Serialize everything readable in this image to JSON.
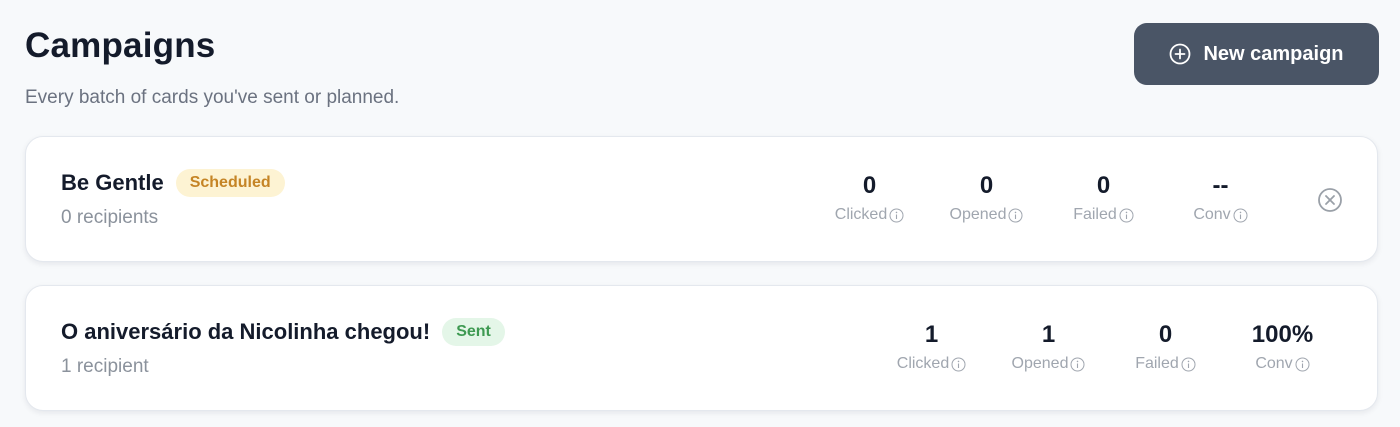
{
  "header": {
    "title": "Campaigns",
    "subtitle": "Every batch of cards you've sent or planned.",
    "new_button_label": "New campaign"
  },
  "campaigns": [
    {
      "name": "Be Gentle",
      "status": "Scheduled",
      "recipients": "0 recipients",
      "stats": [
        {
          "value": "0",
          "label": "Clicked"
        },
        {
          "value": "0",
          "label": "Opened"
        },
        {
          "value": "0",
          "label": "Failed"
        },
        {
          "value": "--",
          "label": "Conv"
        }
      ],
      "has_cancel": true
    },
    {
      "name": "O aniversário da Nicolinha chegou!",
      "status": "Sent",
      "recipients": "1 recipient",
      "stats": [
        {
          "value": "1",
          "label": "Clicked"
        },
        {
          "value": "1",
          "label": "Opened"
        },
        {
          "value": "0",
          "label": "Failed"
        },
        {
          "value": "100%",
          "label": "Conv"
        }
      ],
      "has_cancel": false
    }
  ],
  "icons": {
    "new_button": "plus-circle-icon",
    "stat_info": "info-icon",
    "cancel": "close-circle-icon"
  },
  "colors": {
    "primary_button": "#4a5566",
    "scheduled_badge_bg": "#fdf3d3",
    "scheduled_badge_text": "#c58425",
    "sent_badge_bg": "#e4f6e8",
    "sent_badge_text": "#3e9a52"
  }
}
